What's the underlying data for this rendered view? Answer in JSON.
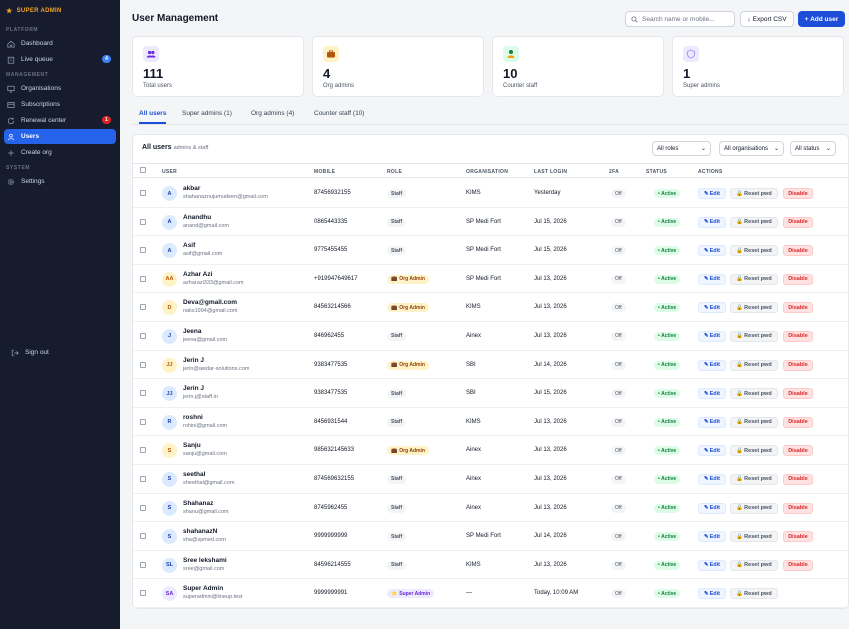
{
  "sidebar": {
    "brand": "SUPER ADMIN",
    "sections": {
      "platform": "PLATFORM",
      "management": "MANAGEMENT",
      "system": "SYSTEM"
    },
    "items": {
      "dashboard": "Dashboard",
      "live_queue": "Live queue",
      "live_queue_badge": "4",
      "organisations": "Organisations",
      "subscriptions": "Subscriptions",
      "renewal_center": "Renewal center",
      "renewal_badge": "1",
      "users": "Users",
      "create_org": "Create org",
      "settings": "Settings"
    },
    "sign_out": "Sign out",
    "active_color": "#2563eb",
    "bg_color": "#161b2e"
  },
  "header": {
    "title": "User Management",
    "search_placeholder": "Search name or mobile...",
    "export_label": "Export CSV",
    "add_label": "+ Add user"
  },
  "stats": [
    {
      "value": "111",
      "label": "Total users",
      "icon": "users-icon"
    },
    {
      "value": "4",
      "label": "Org admins",
      "icon": "briefcase-icon"
    },
    {
      "value": "10",
      "label": "Counter staff",
      "icon": "staff-icon"
    },
    {
      "value": "1",
      "label": "Super admins",
      "icon": "shield-icon"
    }
  ],
  "tabs": [
    "All users",
    "Super admins (1)",
    "Org admins (4)",
    "Counter staff (10)"
  ],
  "table": {
    "title": "All users",
    "subtitle": "admins & staff",
    "filters": {
      "roles": "All roles",
      "orgs": "All organisations",
      "status": "All status"
    },
    "headers": {
      "user": "USER",
      "mobile": "MOBILE",
      "role": "ROLE",
      "organisation": "ORGANISATION",
      "last_login": "LAST LOGIN",
      "tfa": "2FA",
      "status": "STATUS",
      "actions": "ACTIONS"
    },
    "actions": {
      "edit": "Edit",
      "reset": "Reset pwd",
      "disable": "Disable"
    },
    "rows": [
      {
        "initials": "A",
        "name": "akbar",
        "email": "shahanaznujumudeen@gmail.com",
        "mobile": "87456932155",
        "role": "Staff",
        "org": "KIMS",
        "last_login": "Yesterday",
        "tfa": "Off",
        "status": "Active"
      },
      {
        "initials": "A",
        "name": "Anandhu",
        "email": "anand@gmail.com",
        "mobile": "0865443335",
        "role": "Staff",
        "org": "SP Medi Fort",
        "last_login": "Jul 15, 2026",
        "tfa": "Off",
        "status": "Active"
      },
      {
        "initials": "A",
        "name": "Asif",
        "email": "asif@gmail.com",
        "mobile": "9775455455",
        "role": "Staff",
        "org": "SP Medi Fort",
        "last_login": "Jul 15, 2026",
        "tfa": "Off",
        "status": "Active"
      },
      {
        "initials": "AA",
        "name": "Azhar Azi",
        "email": "azharazi333@gmail.com",
        "mobile": "+919947649617",
        "role": "Org Admin",
        "org": "SP Medi Fort",
        "last_login": "Jul 13, 2026",
        "tfa": "Off",
        "status": "Active"
      },
      {
        "initials": "D",
        "name": "Deva@gmail.com",
        "email": "naks1994@gmail.com",
        "mobile": "84563214566",
        "role": "Org Admin",
        "org": "KIMS",
        "last_login": "Jul 13, 2026",
        "tfa": "Off",
        "status": "Active"
      },
      {
        "initials": "J",
        "name": "Jeena",
        "email": "jeena@gmail.com",
        "mobile": "846962455",
        "role": "Staff",
        "org": "Ainex",
        "last_login": "Jul 13, 2026",
        "tfa": "Off",
        "status": "Active"
      },
      {
        "initials": "JJ",
        "name": "Jerin J",
        "email": "jerin@awdar-solutions.com",
        "mobile": "9383477535",
        "role": "Org Admin",
        "org": "SBI",
        "last_login": "Jul 14, 2026",
        "tfa": "Off",
        "status": "Active"
      },
      {
        "initials": "JJ",
        "name": "Jerin J",
        "email": "jerin.j@staff.in",
        "mobile": "9383477535",
        "role": "Staff",
        "org": "SBI",
        "last_login": "Jul 15, 2026",
        "tfa": "Off",
        "status": "Active"
      },
      {
        "initials": "R",
        "name": "roshni",
        "email": "rohini@gmail.com",
        "mobile": "8456931544",
        "role": "Staff",
        "org": "KIMS",
        "last_login": "Jul 13, 2026",
        "tfa": "Off",
        "status": "Active"
      },
      {
        "initials": "S",
        "name": "Sanju",
        "email": "sanju@gmail.com",
        "mobile": "985632145633",
        "role": "Org Admin",
        "org": "Ainex",
        "last_login": "Jul 13, 2026",
        "tfa": "Off",
        "status": "Active"
      },
      {
        "initials": "S",
        "name": "seethal",
        "email": "sheethal@gmail.com",
        "mobile": "874569632155",
        "role": "Staff",
        "org": "Ainex",
        "last_login": "Jul 13, 2026",
        "tfa": "Off",
        "status": "Active"
      },
      {
        "initials": "S",
        "name": "Shahanaz",
        "email": "shanu@gmail.com",
        "mobile": "8745962455",
        "role": "Staff",
        "org": "Ainex",
        "last_login": "Jul 13, 2026",
        "tfa": "Off",
        "status": "Active"
      },
      {
        "initials": "S",
        "name": "shahanazN",
        "email": "sha@spmed.com",
        "mobile": "9999999999",
        "role": "Staff",
        "org": "SP Medi Fort",
        "last_login": "Jul 14, 2026",
        "tfa": "Off",
        "status": "Active"
      },
      {
        "initials": "SL",
        "name": "Sree lekshami",
        "email": "sree@gmail.com",
        "mobile": "84596214555",
        "role": "Staff",
        "org": "KIMS",
        "last_login": "Jul 13, 2026",
        "tfa": "Off",
        "status": "Active"
      },
      {
        "initials": "SA",
        "name": "Super Admin",
        "email": "superadmin@lineup.test",
        "mobile": "9999999991",
        "role": "Super Admin",
        "org": "—",
        "last_login": "Today, 10:09 AM",
        "tfa": "Off",
        "status": "Active"
      }
    ]
  },
  "colors": {
    "primary": "#1d4ed8",
    "active_green": "#15803d",
    "danger": "#dc2626",
    "org_admin": "#92400e",
    "super_admin": "#6d28d9"
  }
}
